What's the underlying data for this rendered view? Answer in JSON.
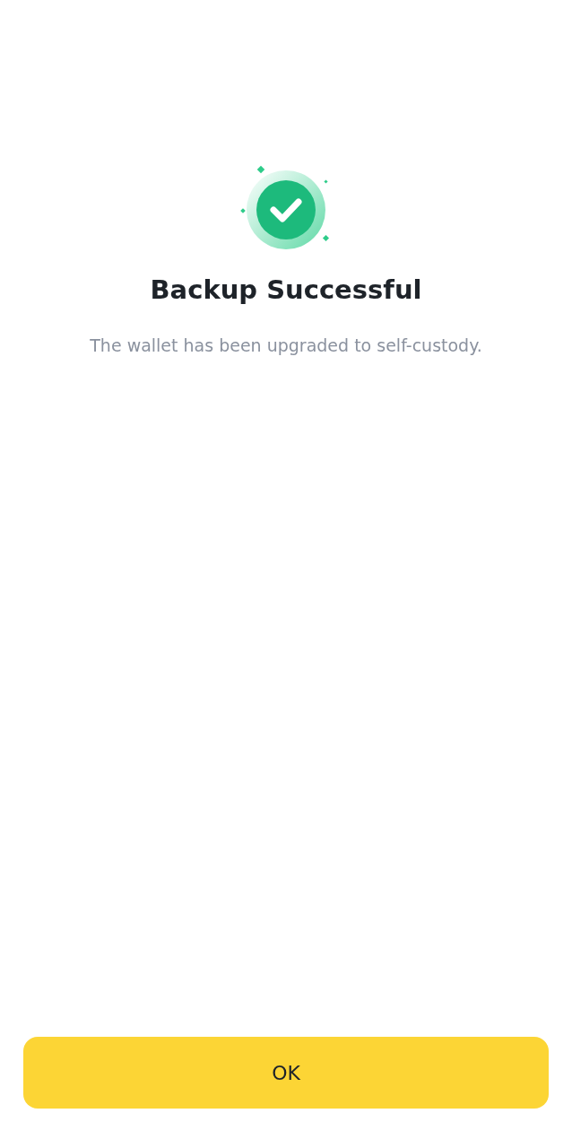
{
  "result": {
    "success": true,
    "title": "Backup Successful",
    "message": "The wallet has been upgraded to self-custody."
  },
  "buttons": [
    {
      "label": "OK"
    }
  ]
}
